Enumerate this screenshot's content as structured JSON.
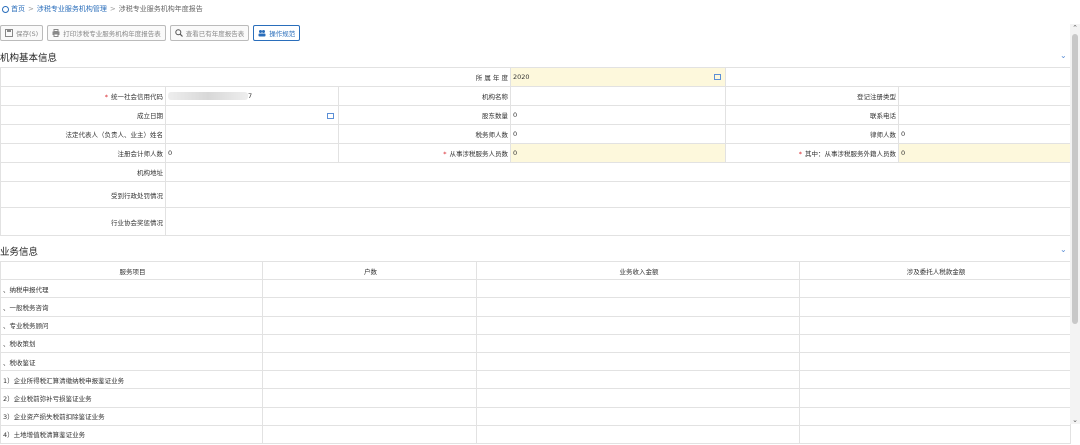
{
  "breadcrumb": {
    "home": "首页",
    "level1": "涉税专业服务机构管理",
    "current": "涉税专业服务机构年度报告",
    "separator": ">"
  },
  "toolbar": {
    "save": "保存(S)",
    "print": "打印涉税专业服务机构年度报告表",
    "view": "查看已有年度报告表",
    "guide": "操作规范"
  },
  "basic_section": {
    "title": "机构基本信息",
    "year_label": "所 属 年 度",
    "year_value": "2020",
    "credit_code_label": "统一社会信用代码",
    "credit_code_suffix": "7",
    "org_name_label": "机构名称",
    "reg_type_label": "登记注册类型",
    "setup_date_label": "成立日期",
    "shareholders_label": "股东数量",
    "shareholders_value": "0",
    "phone_label": "联系电话",
    "legal_rep_label": "法定代表人（负责人、业主）姓名",
    "tax_agents_label": "税务师人数",
    "tax_agents_value": "0",
    "lawyers_label": "律师人数",
    "lawyers_value": "0",
    "cpa_label": "注册会计师人数",
    "cpa_value": "0",
    "staff_label": "从事涉税服务人员数",
    "staff_value": "0",
    "foreign_staff_label": "其中：从事涉税服务外籍人员数",
    "foreign_staff_value": "0",
    "address_label": "机构地址",
    "penalty_label": "受到行政处罚情况",
    "awards_label": "行业协会奖惩情况"
  },
  "business_section": {
    "title": "业务信息",
    "columns": [
      "服务项目",
      "户数",
      "业务收入金额",
      "涉及委托人税款金额"
    ],
    "rows": [
      "、纳税申报代理",
      "、一般税务咨询",
      "、专业税务顾问",
      "、税收策划",
      "、税收鉴证",
      "1）企业所得税汇算清缴纳税申报鉴证业务",
      "2）企业税前弥补亏损鉴证业务",
      "3）企业资产损失税前扣除鉴证业务",
      "4）土地增值税清算鉴证业务"
    ]
  },
  "colors": {
    "link": "#2a6ebb",
    "highlight": "#fdf8dc",
    "required": "#d9262c"
  }
}
